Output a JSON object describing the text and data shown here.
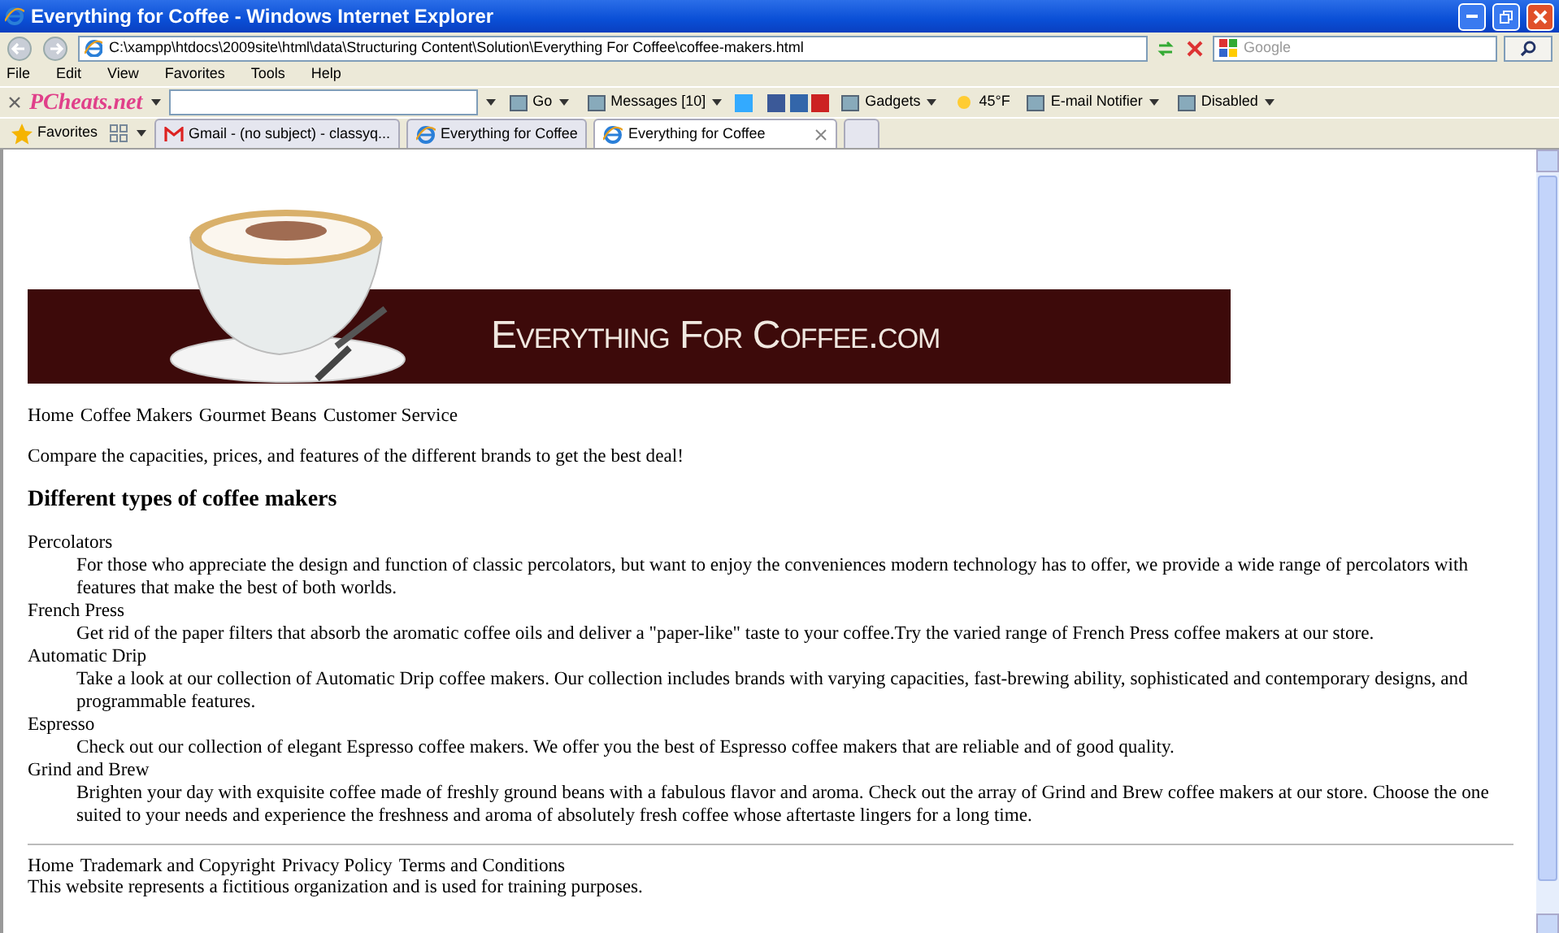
{
  "window": {
    "title": "Everything for Coffee - Windows Internet Explorer"
  },
  "address_bar": {
    "url": "C:\\xampp\\htdocs\\2009site\\html\\data\\Structuring Content\\Solution\\Everything For Coffee\\coffee-makers.html",
    "search_placeholder": "Google"
  },
  "menu": [
    "File",
    "Edit",
    "View",
    "Favorites",
    "Tools",
    "Help"
  ],
  "toolbar": {
    "brand": "PCheats.net",
    "items": [
      {
        "kind": "button",
        "label": "Go"
      },
      {
        "kind": "button",
        "label": "Messages [10]"
      },
      {
        "kind": "social"
      },
      {
        "kind": "button",
        "label": "Gadgets"
      },
      {
        "kind": "weather",
        "label": "45°F"
      },
      {
        "kind": "button",
        "label": "E-mail Notifier"
      },
      {
        "kind": "button",
        "label": "Disabled"
      }
    ]
  },
  "favorites_bar": {
    "label": "Favorites",
    "tabs": [
      {
        "kind": "mail",
        "label": "Gmail - (no subject) - classyq...",
        "selected": false
      },
      {
        "kind": "ie",
        "label": "Everything for Coffee",
        "selected": false
      },
      {
        "kind": "ie",
        "label": "Everything for Coffee",
        "selected": true
      }
    ]
  },
  "page": {
    "banner_text": "Everything For Coffee.com",
    "nav": [
      "Home",
      "Coffee Makers",
      "Gourmet Beans",
      "Customer Service"
    ],
    "intro": "Compare the capacities, prices, and features of the different brands to get the best deal!",
    "heading": "Different types of coffee makers",
    "definitions": [
      {
        "term": "Percolators",
        "description": "For those who appreciate the design and function of classic percolators, but want to enjoy the conveniences modern technology has to offer, we provide a wide range of percolators with features that make the best of both worlds."
      },
      {
        "term": "French Press",
        "description": "Get rid of the paper filters that absorb the aromatic coffee oils and deliver a \"paper-like\" taste to your coffee.Try the varied range of French Press coffee makers at our store."
      },
      {
        "term": "Automatic Drip",
        "description": "Take a look at our collection of Automatic Drip coffee makers. Our collection includes brands with varying capacities, fast-brewing ability, sophisticated and contemporary designs, and programmable features."
      },
      {
        "term": "Espresso",
        "description": "Check out our collection of elegant Espresso coffee makers. We offer you the best of Espresso coffee makers that are reliable and of good quality."
      },
      {
        "term": "Grind and Brew",
        "description": "Brighten your day with exquisite coffee made of freshly ground beans with a fabulous flavor and aroma. Check out the array of Grind and Brew coffee makers at our store. Choose the one suited to your needs and experience the freshness and aroma of absolutely fresh coffee whose aftertaste lingers for a long time."
      }
    ],
    "footer_links": [
      "Home",
      "Trademark and Copyright",
      "Privacy Policy",
      "Terms and Conditions"
    ],
    "footer_note": "This website represents a fictitious organization and is used for training purposes."
  }
}
